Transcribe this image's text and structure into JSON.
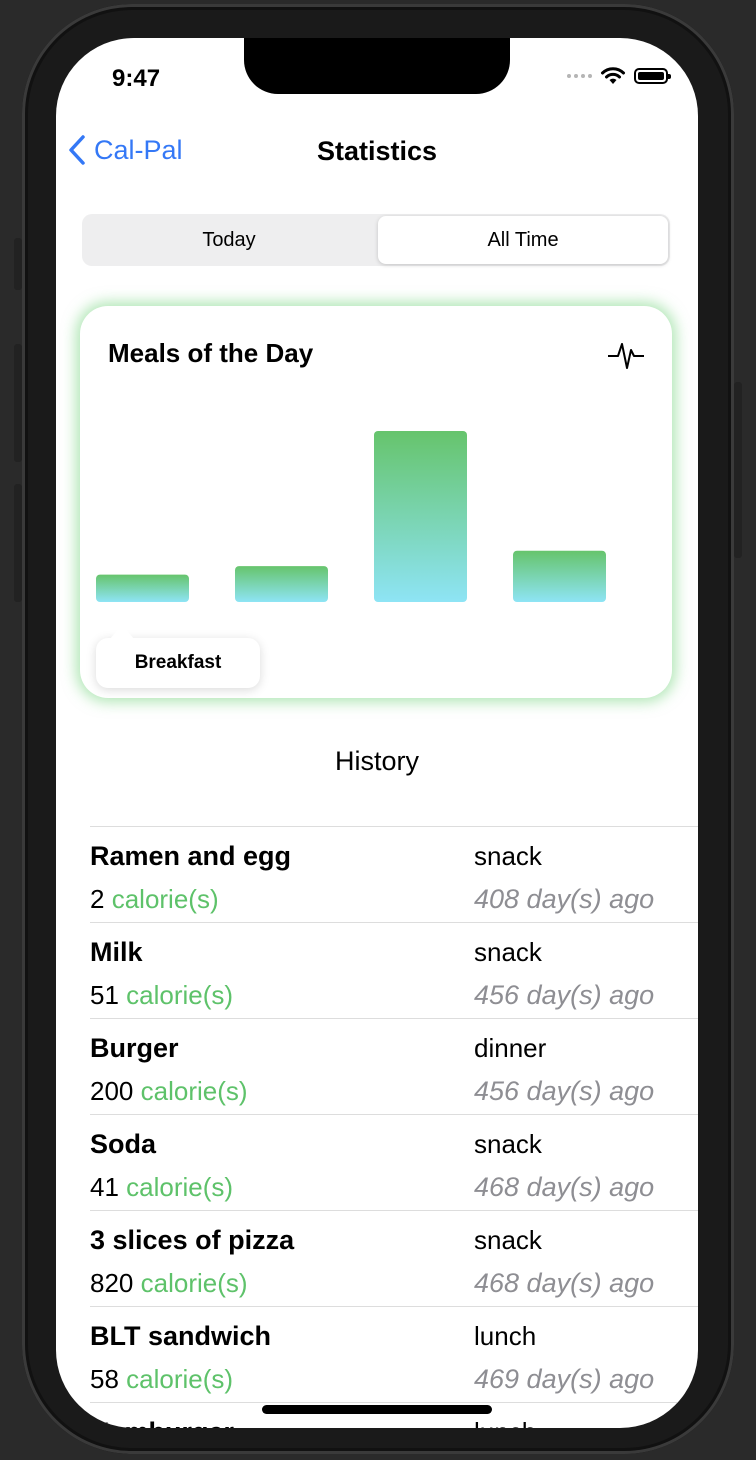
{
  "status_bar": {
    "time": "9:47"
  },
  "nav": {
    "back_label": "Cal-Pal",
    "title": "Statistics"
  },
  "segmented": {
    "options": [
      "Today",
      "All Time"
    ],
    "selected": "All Time"
  },
  "card": {
    "title": "Meals of the Day",
    "icon": "heart-pulse-icon"
  },
  "chart_data": {
    "type": "bar",
    "categories": [
      "Breakfast",
      "",
      "",
      ""
    ],
    "values": [
      1.6,
      2.1,
      10,
      3.0
    ],
    "ylim": [
      0,
      10
    ],
    "gradient": {
      "top": "#66c46c",
      "bottom": "#8ee4f5"
    },
    "selected_tooltip": "Breakfast"
  },
  "history": {
    "title": "History",
    "unit_label": "calorie(s)",
    "items": [
      {
        "name": "Ramen and egg",
        "calories": "2",
        "meal": "snack",
        "ago": "408 day(s) ago"
      },
      {
        "name": "Milk",
        "calories": "51",
        "meal": "snack",
        "ago": "456 day(s) ago"
      },
      {
        "name": "Burger",
        "calories": "200",
        "meal": "dinner",
        "ago": "456 day(s) ago"
      },
      {
        "name": "Soda",
        "calories": "41",
        "meal": "snack",
        "ago": "468 day(s) ago"
      },
      {
        "name": "3 slices of pizza",
        "calories": "820",
        "meal": "snack",
        "ago": "468 day(s) ago"
      },
      {
        "name": "BLT sandwich",
        "calories": "58",
        "meal": "lunch",
        "ago": "469 day(s) ago"
      },
      {
        "name": "Hamburger",
        "calories": "",
        "meal": "lunch",
        "ago": ""
      }
    ]
  },
  "colors": {
    "accent": "#3478f6",
    "calorie_unit": "#5ec26a",
    "glow": "#70d278"
  }
}
